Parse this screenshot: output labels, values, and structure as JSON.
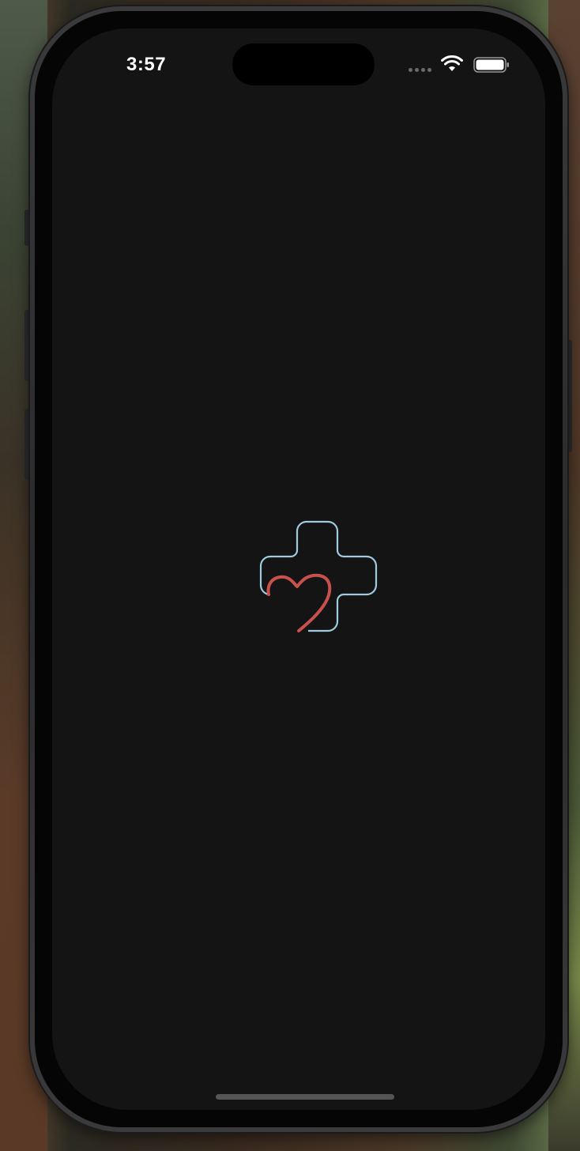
{
  "status_bar": {
    "time": "3:57"
  },
  "icons": {
    "wifi": "wifi-icon",
    "battery": "battery-icon",
    "signal": "cellular-signal-icon",
    "logo": "medical-cross-heart-logo"
  },
  "colors": {
    "screen_background": "#141414",
    "cross_outline": "#9ecbe0",
    "heart_stroke": "#c8514e"
  }
}
